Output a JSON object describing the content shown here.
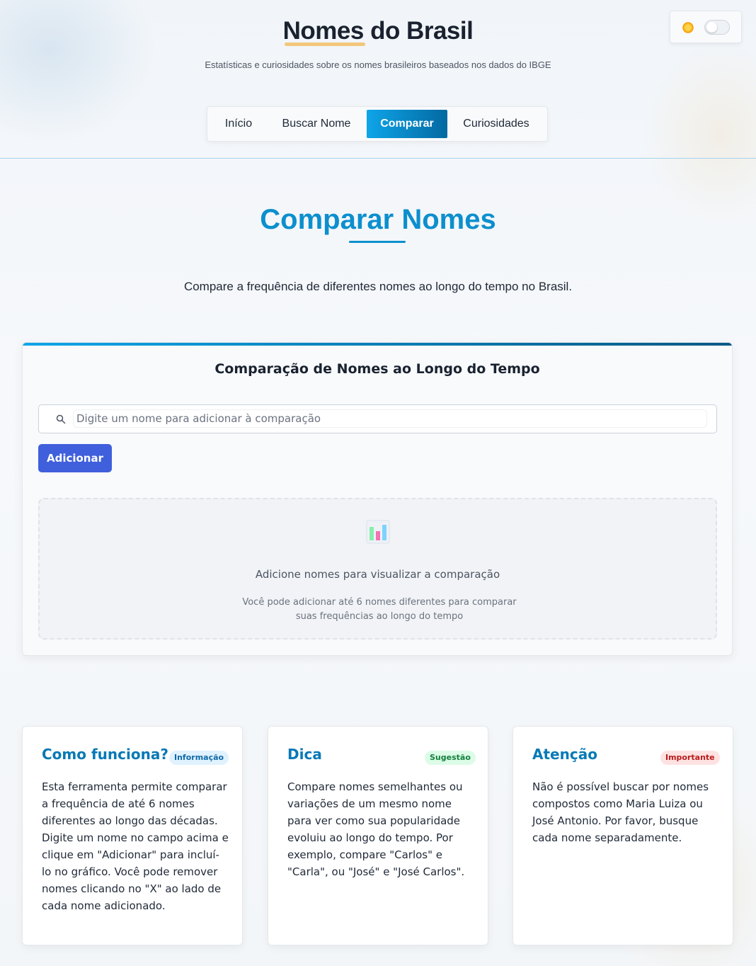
{
  "header": {
    "title": "Nomes do Brasil",
    "subtitle": "Estatísticas e curiosidades sobre os nomes brasileiros baseados nos dados do IBGE"
  },
  "theme_toggle": {
    "icon": "sun-icon",
    "state": "off"
  },
  "nav": {
    "items": [
      {
        "label": "Início",
        "active": false
      },
      {
        "label": "Buscar Nome",
        "active": false
      },
      {
        "label": "Comparar",
        "active": true
      },
      {
        "label": "Curiosidades",
        "active": false
      }
    ]
  },
  "main": {
    "title": "Comparar Nomes",
    "description": "Compare a frequência de diferentes nomes ao longo do tempo no Brasil."
  },
  "compare_card": {
    "title": "Comparação de Nomes ao Longo do Tempo",
    "search": {
      "placeholder": "Digite um nome para adicionar à comparação",
      "value": ""
    },
    "add_button_label": "Adicionar",
    "empty_state": {
      "icon": "bar-chart-icon",
      "title": "Adicione nomes para visualizar a comparação",
      "subtitle": "Você pode adicionar até 6 nomes diferentes para comparar suas frequências ao longo do tempo"
    }
  },
  "info_cards": [
    {
      "title": "Como funciona?",
      "badge": "Informação",
      "text": "Esta ferramenta permite comparar a frequência de até 6 nomes diferentes ao longo das décadas. Digite um nome no campo acima e clique em \"Adicionar\" para incluí-lo no gráfico. Você pode remover nomes clicando no \"X\" ao lado de cada nome adicionado."
    },
    {
      "title": "Dica",
      "badge": "Sugestão",
      "text": "Compare nomes semelhantes ou variações de um mesmo nome para ver como sua popularidade evoluiu ao longo do tempo. Por exemplo, compare \"Carlos\" e \"Carla\", ou \"José\" e \"José Carlos\"."
    },
    {
      "title": "Atenção",
      "badge": "Importante",
      "text": "Não é possível buscar por nomes compostos como Maria Luiza ou José Antonio. Por favor, busque cada nome separadamente."
    }
  ],
  "colors": {
    "accent": "#0c8fce",
    "nav_active_start": "#0ea5e9",
    "nav_active_end": "#0369a1",
    "add_button": "#3f5fdc",
    "title_highlight": "#f2c77b"
  }
}
